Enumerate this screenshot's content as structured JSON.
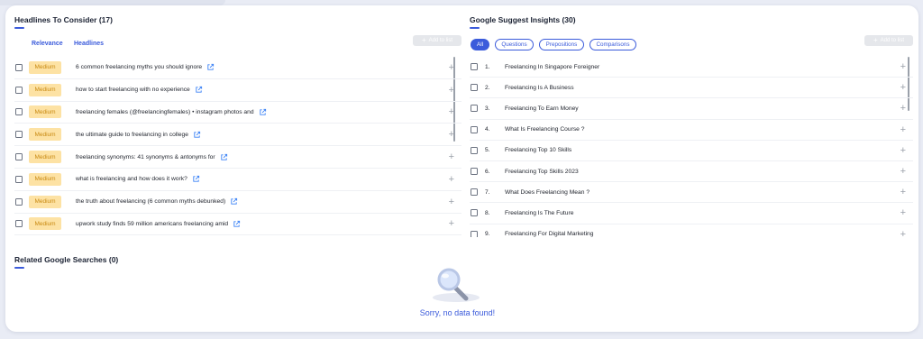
{
  "headlines": {
    "title": "Headlines To Consider (17)",
    "col_relevance": "Relevance",
    "col_headlines": "Headlines",
    "add_to_list": "Add to list",
    "rows": [
      {
        "relevance": "Medium",
        "text": "6 common freelancing myths you should ignore"
      },
      {
        "relevance": "Medium",
        "text": "how to start freelancing with no experience"
      },
      {
        "relevance": "Medium",
        "text": "freelancing females (@freelancingfemales) • instagram photos and"
      },
      {
        "relevance": "Medium",
        "text": "the ultimate guide to freelancing in college"
      },
      {
        "relevance": "Medium",
        "text": "freelancing synonyms: 41 synonyms & antonyms for"
      },
      {
        "relevance": "Medium",
        "text": "what is freelancing and how does it work?"
      },
      {
        "relevance": "Medium",
        "text": "the truth about freelancing (6 common myths debunked)"
      },
      {
        "relevance": "Medium",
        "text": "upwork study finds 59 million americans freelancing amid"
      }
    ]
  },
  "suggest": {
    "title": "Google Suggest Insights (30)",
    "add_to_list": "Add to list",
    "filters": [
      "All",
      "Questions",
      "Prepositions",
      "Comparisons"
    ],
    "active_filter": "All",
    "rows": [
      {
        "num": "1.",
        "text": "Freelancing In Singapore Foreigner"
      },
      {
        "num": "2.",
        "text": "Freelancing Is A Business"
      },
      {
        "num": "3.",
        "text": "Freelancing To Earn Money"
      },
      {
        "num": "4.",
        "text": "What Is Freelancing Course ?"
      },
      {
        "num": "5.",
        "text": "Freelancing Top 10 Skills"
      },
      {
        "num": "6.",
        "text": "Freelancing Top Skills 2023"
      },
      {
        "num": "7.",
        "text": "What Does Freelancing Mean ?"
      },
      {
        "num": "8.",
        "text": "Freelancing Is The Future"
      },
      {
        "num": "9.",
        "text": "Freelancing For Digital Marketing"
      }
    ]
  },
  "related": {
    "title": "Related Google Searches (0)",
    "empty_message": "Sorry, no data found!"
  },
  "colors": {
    "accent": "#3b5bdb",
    "badge_bg": "#fde2a4",
    "badge_text": "#c98a12"
  }
}
